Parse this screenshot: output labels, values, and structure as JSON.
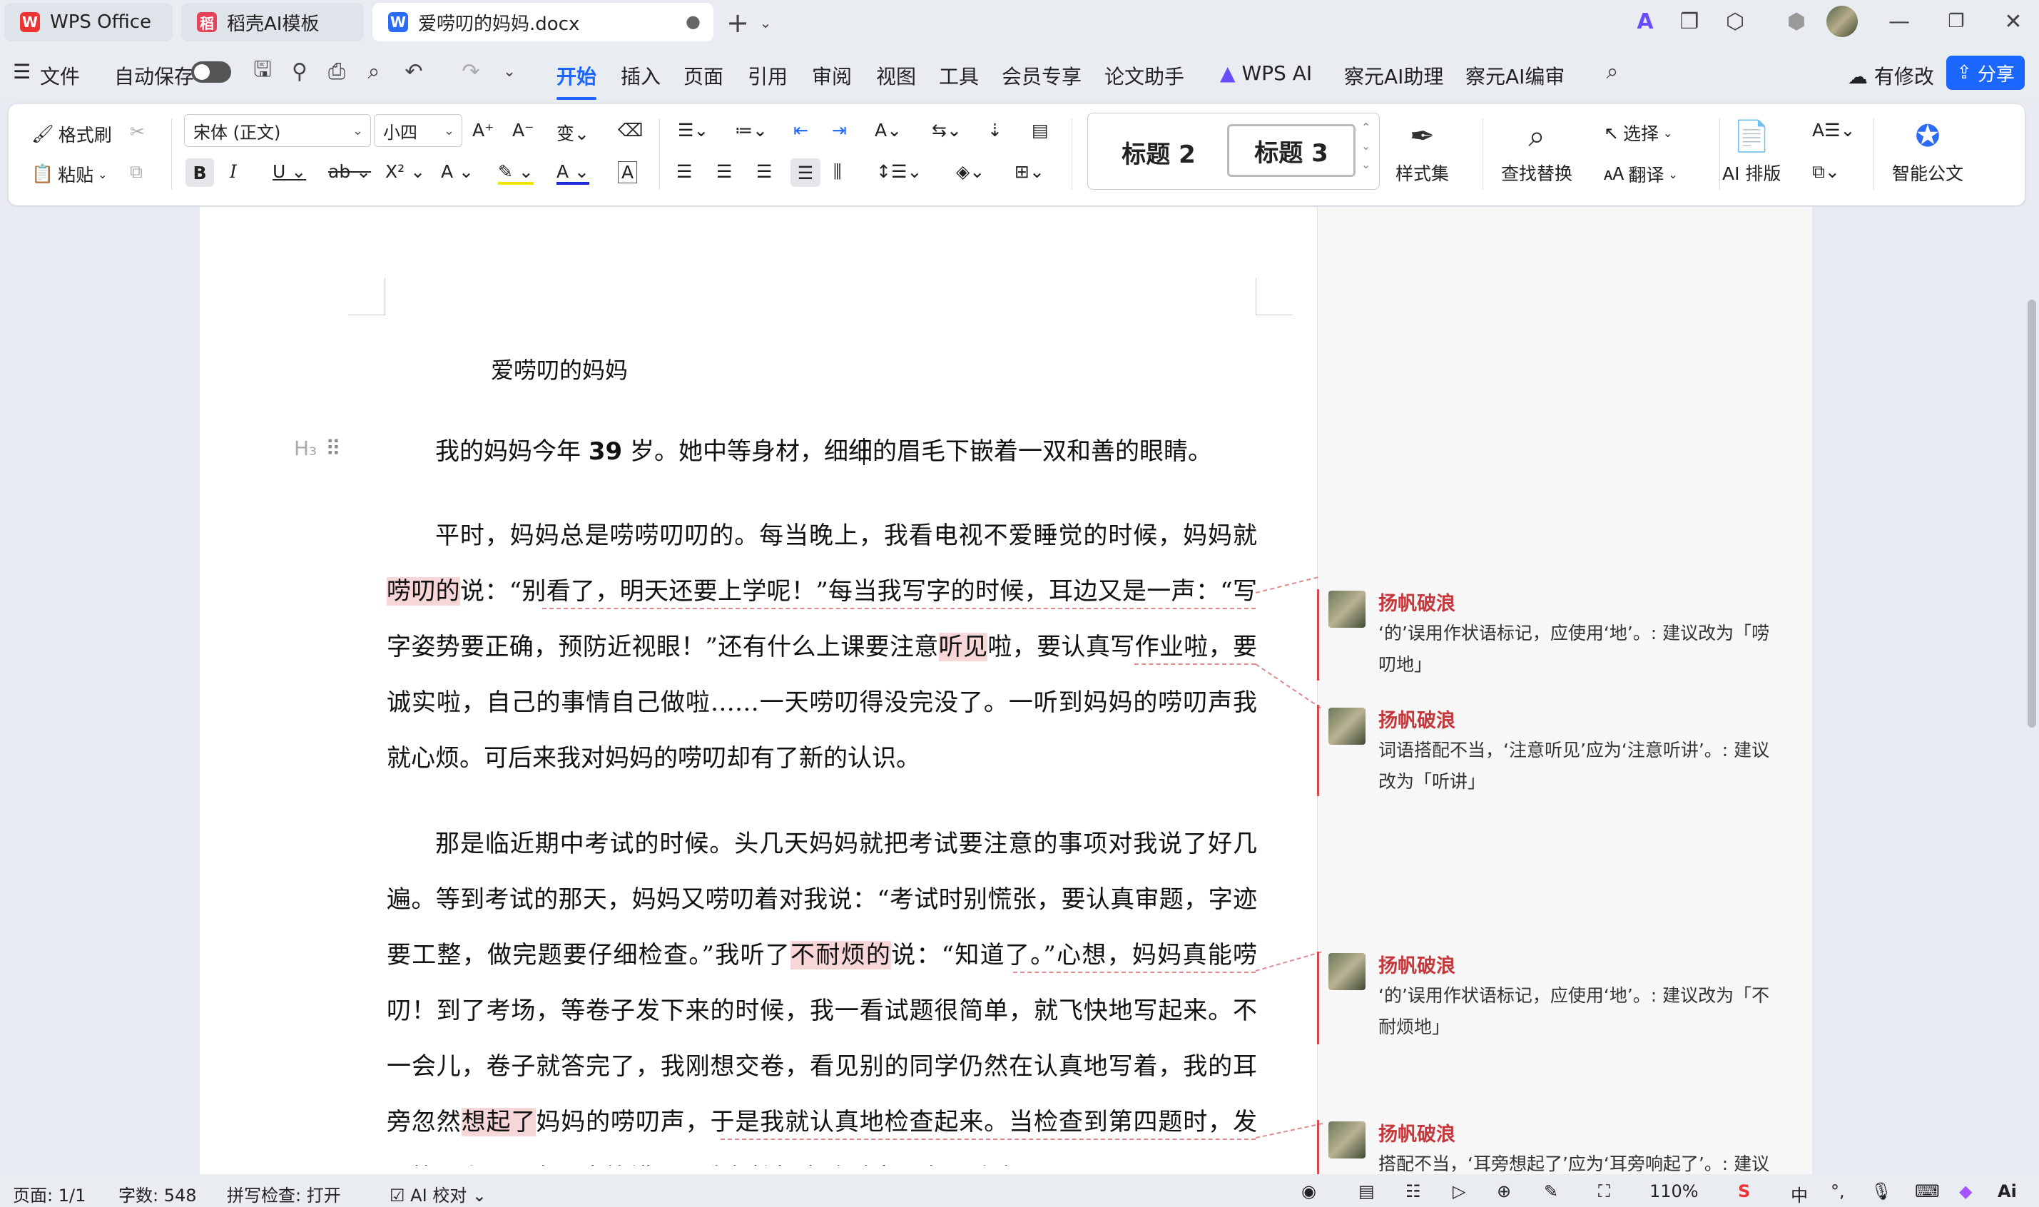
{
  "tabs": {
    "wps": "WPS Office",
    "daoke": "稻壳AI模板",
    "doc": "爱唠叨的妈妈.docx"
  },
  "menu": {
    "file": "文件",
    "autosave": "自动保存",
    "items": [
      "开始",
      "插入",
      "页面",
      "引用",
      "审阅",
      "视图",
      "工具",
      "会员专享",
      "论文助手",
      "WPS AI",
      "察元AI助理",
      "察元AI编审"
    ],
    "modified": "有修改",
    "share": "分享"
  },
  "ribbon": {
    "format_painter": "格式刷",
    "paste": "粘贴",
    "font": "宋体 (正文)",
    "size": "小四",
    "style1": "标题  2",
    "style2": "标题  3",
    "style_set": "样式集",
    "find_replace": "查找替换",
    "select": "选择",
    "translate": "翻译",
    "ai_layout": "AI 排版",
    "smart_doc": "智能公文"
  },
  "document": {
    "title": "爱唠叨的妈妈",
    "p1": "我的妈妈今年",
    "p1_num": "39",
    "p1_rest": "岁。她中等身材，细细的眉毛下嵌着一双和善的眼睛。",
    "p2_a": "平时，妈妈总是唠唠叨叨的。每当晚上，我看电视不爱睡觉的时候，妈妈就",
    "p2_h1": "唠叨的",
    "p2_b": "说：“别看了，明天还要上学呢！”每当我写字的时候，耳边又是一声：“写字姿势要正确，预防近视眼！”还有什么上课要注意",
    "p2_h2": "听见",
    "p2_c": "啦，要认真写作业啦，要诚实啦，自己的事情自己做啦……一天唠叨得没完没了。一听到妈妈的唠叨声我就心烦。可后来我对妈妈的唠叨却有了新的认识。",
    "p3_a": "那是临近期中考试的时候。头几天妈妈就把考试要注意的事项对我说了好几遍。等到考试的那天，妈妈又唠叨着对我说：“考试时别慌张，要认真审题，字迹要工整，做完题要仔细检查。”我听了",
    "p3_h1": "不耐烦的",
    "p3_b": "说：“知道了。”心想，妈妈真能唠叨！到了考场，等卷子发下来的时候，我一看试题很简单，就飞快地写起来。不一会儿，卷子就答完了，我刚想交卷，看见别的同学仍然在认真地写着，我的耳旁忽然",
    "p3_h2": "想起了",
    "p3_c": "妈妈的唠叨声，于是我就认真地检查起来。当检查到第四题时，发现第一小题因为马虎算错了，我急忙把它改过来，为了防止"
  },
  "comments": [
    {
      "author": "扬帆破浪",
      "text": "‘的’误用作状语标记，应使用‘地’。: 建议改为「唠叨地」"
    },
    {
      "author": "扬帆破浪",
      "text": "词语搭配不当，‘注意听见’应为‘注意听讲’。: 建议改为「听讲」"
    },
    {
      "author": "扬帆破浪",
      "text": "‘的’误用作状语标记，应使用‘地’。: 建议改为「不耐烦地」"
    },
    {
      "author": "扬帆破浪",
      "text": "搭配不当，‘耳旁想起了’应为‘耳旁响起了’。: 建议"
    }
  ],
  "status": {
    "page": "页面: 1/1",
    "words": "字数: 548",
    "spell": "拼写检查: 打开",
    "ai_check": "AI 校对",
    "zoom": "110%",
    "ime": "中"
  }
}
